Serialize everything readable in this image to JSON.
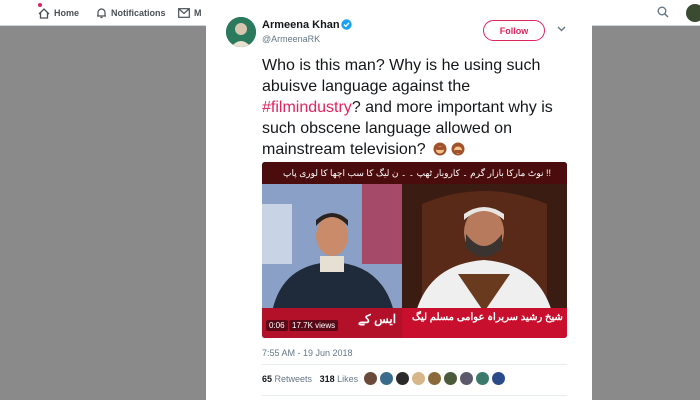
{
  "nav": {
    "home_label": "Home",
    "notifications_label": "Notifications",
    "messages_label": "M"
  },
  "tweet": {
    "author_name": "Armeena Khan",
    "author_handle": "@ArmeenaRK",
    "follow_label": "Follow",
    "text_part1": "Who is this man? Why is he using such abuisve language against the ",
    "hashtag": "#filmindustry",
    "text_part2": "? and more important why is such obscene language allowed on mainstream television?",
    "timestamp": "7:55 AM - 19 Jun 2018",
    "retweets_count": "65",
    "retweets_label": "Retweets",
    "likes_count": "318",
    "likes_label": "Likes"
  },
  "video": {
    "ticker_text": "نوٹ مارکا بازار گرم ۔ کاروبار ٹھپ ۔ ۔ ن لیگ کا سب اچھا کا لوری پاپ !!",
    "lower_left_text": "ایس کے",
    "lower_right_text": "شیخ رشید  سربراہ عوامی مسلم لیگ",
    "duration": "0:06",
    "views": "17.7K views"
  },
  "colors": {
    "accent": "#e0245e",
    "verified": "#1da1f2",
    "overlay": "#808080"
  },
  "icons": {
    "home": "home-icon",
    "notifications": "bell-icon",
    "messages": "envelope-icon",
    "search": "search-icon",
    "verified": "verified-badge-icon",
    "caret": "chevron-down-icon",
    "emoji": "speak-no-evil-monkey-emoji"
  }
}
